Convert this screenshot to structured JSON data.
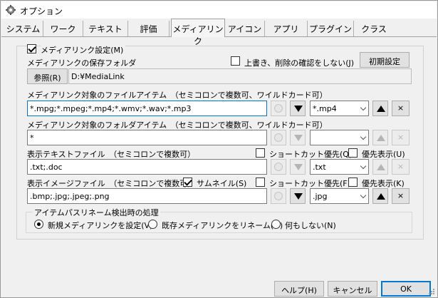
{
  "window": {
    "title": "オプション",
    "icon": "gear-icon"
  },
  "tabs": [
    {
      "label": "システム",
      "active": false
    },
    {
      "label": "ワーク",
      "active": false
    },
    {
      "label": "テキスト",
      "active": false
    },
    {
      "label": "評価",
      "active": false
    },
    {
      "label": "メディアリンク",
      "active": true
    },
    {
      "label": "アイコン",
      "active": false
    },
    {
      "label": "アプリ",
      "active": false
    },
    {
      "label": "プラグイン",
      "active": false
    },
    {
      "label": "クラス",
      "active": false
    }
  ],
  "media": {
    "enable_label": "メディアリンク設定(M)",
    "enable_checked": true,
    "folder_label": "メディアリンクの保存フォルダ",
    "no_confirm_label": "上書き、削除の確認をしない(J)",
    "no_confirm_checked": false,
    "reset_button": "初期設定",
    "browse_button": "参照(R)",
    "folder_value": "D:¥MediaLink",
    "file_items_label": "メディアリンク対象のファイルアイテム　（セミコロンで複数可、ワイルドカード可）",
    "file_items_value": "*.mpg;*.mpeg;*.mp4;*.wmv;*.wav;*.mp3",
    "file_items_combo": "*.mp4",
    "folder_items_label": "メディアリンク対象のフォルダアイテム　（セミコロンで複数可、ワイルドカード可）",
    "folder_items_value": "*",
    "folder_items_combo": "",
    "text_file_label": "表示テキストファイル　（セミコロンで複数可）",
    "text_shortcut_label": "ショートカット優先(Q)",
    "text_shortcut_checked": false,
    "text_priority_label": "優先表示(U)",
    "text_priority_checked": false,
    "text_file_value": ".txt;.doc",
    "text_file_combo": ".txt",
    "image_file_label": "表示イメージファイル　（セミコロンで複数可）",
    "thumbnail_label": "サムネイル(S)",
    "thumbnail_checked": true,
    "image_shortcut_label": "ショートカット優先(F)",
    "image_shortcut_checked": false,
    "image_priority_label": "優先表示(K)",
    "image_priority_checked": false,
    "image_file_value": ".bmp;.jpg;.jpeg;.png",
    "image_file_combo": ".jpg",
    "rename_group_label": "アイテムパスリネーム検出時の処理",
    "rename_options": [
      {
        "label": "新規メディアリンクを設定(V)",
        "selected": true
      },
      {
        "label": "既存メディアリンクをリネーム(O)",
        "selected": false
      },
      {
        "label": "何もしない(N)",
        "selected": false
      }
    ],
    "delete_symbol": "×"
  },
  "footer": {
    "help_button": "ヘルプ(H)",
    "cancel_button": "キャンセル",
    "ok_button": "OK"
  }
}
